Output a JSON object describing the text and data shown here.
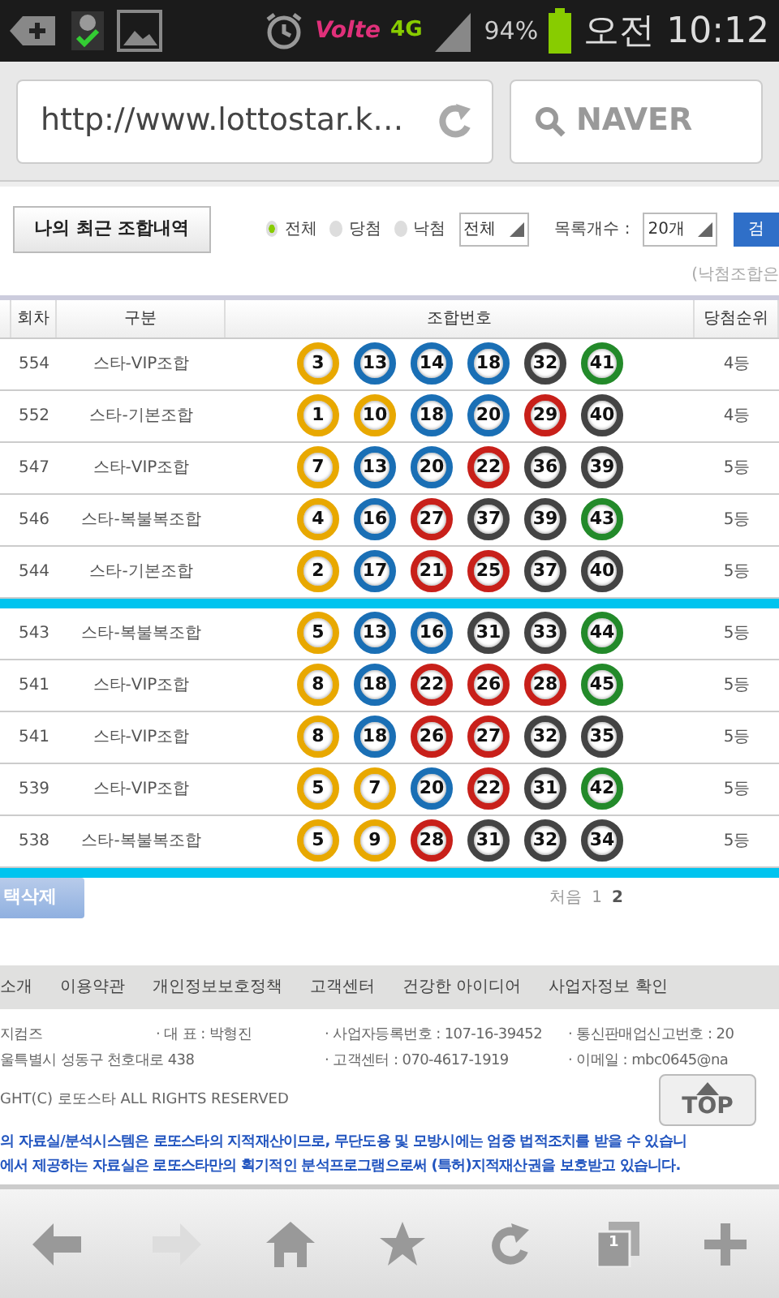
{
  "status_bar": {
    "network": "Volte",
    "data": "4G",
    "battery": "94%",
    "time": "오전 10:12"
  },
  "browser": {
    "url": "http://www.lottostar.k…",
    "search_placeholder": "NAVER"
  },
  "toolbar": {
    "history_button": "나의 최근 조합내역",
    "filters": [
      {
        "label": "전체",
        "selected": true
      },
      {
        "label": "당첨",
        "selected": false
      },
      {
        "label": "낙첨",
        "selected": false
      }
    ],
    "type_select": "전체",
    "count_label": "목록개수 :",
    "count_select": "20개",
    "search_button": "검",
    "note": "(낙첨조합은"
  },
  "table": {
    "columns": [
      "회차",
      "구분",
      "조합번호",
      "당첨순위"
    ],
    "groups": [
      [
        {
          "round": "554",
          "type": "스타-VIP조합",
          "rank": "4등",
          "balls": [
            {
              "n": "3",
              "color": "#e8a800"
            },
            {
              "n": "13",
              "color": "#1a6fb5"
            },
            {
              "n": "14",
              "color": "#1a6fb5"
            },
            {
              "n": "18",
              "color": "#1a6fb5"
            },
            {
              "n": "32",
              "color": "#444444"
            },
            {
              "n": "41",
              "color": "#238a2a"
            }
          ]
        },
        {
          "round": "552",
          "type": "스타-기본조합",
          "rank": "4등",
          "balls": [
            {
              "n": "1",
              "color": "#e8a800"
            },
            {
              "n": "10",
              "color": "#e8a800"
            },
            {
              "n": "18",
              "color": "#1a6fb5"
            },
            {
              "n": "20",
              "color": "#1a6fb5"
            },
            {
              "n": "29",
              "color": "#c8201a"
            },
            {
              "n": "40",
              "color": "#444444"
            }
          ]
        },
        {
          "round": "547",
          "type": "스타-VIP조합",
          "rank": "5등",
          "balls": [
            {
              "n": "7",
              "color": "#e8a800"
            },
            {
              "n": "13",
              "color": "#1a6fb5"
            },
            {
              "n": "20",
              "color": "#1a6fb5"
            },
            {
              "n": "22",
              "color": "#c8201a"
            },
            {
              "n": "36",
              "color": "#444444"
            },
            {
              "n": "39",
              "color": "#444444"
            }
          ]
        },
        {
          "round": "546",
          "type": "스타-복불복조합",
          "rank": "5등",
          "balls": [
            {
              "n": "4",
              "color": "#e8a800"
            },
            {
              "n": "16",
              "color": "#1a6fb5"
            },
            {
              "n": "27",
              "color": "#c8201a"
            },
            {
              "n": "37",
              "color": "#444444"
            },
            {
              "n": "39",
              "color": "#444444"
            },
            {
              "n": "43",
              "color": "#238a2a"
            }
          ]
        },
        {
          "round": "544",
          "type": "스타-기본조합",
          "rank": "5등",
          "balls": [
            {
              "n": "2",
              "color": "#e8a800"
            },
            {
              "n": "17",
              "color": "#1a6fb5"
            },
            {
              "n": "21",
              "color": "#c8201a"
            },
            {
              "n": "25",
              "color": "#c8201a"
            },
            {
              "n": "37",
              "color": "#444444"
            },
            {
              "n": "40",
              "color": "#444444"
            }
          ]
        }
      ],
      [
        {
          "round": "543",
          "type": "스타-복불복조합",
          "rank": "5등",
          "balls": [
            {
              "n": "5",
              "color": "#e8a800"
            },
            {
              "n": "13",
              "color": "#1a6fb5"
            },
            {
              "n": "16",
              "color": "#1a6fb5"
            },
            {
              "n": "31",
              "color": "#444444"
            },
            {
              "n": "33",
              "color": "#444444"
            },
            {
              "n": "44",
              "color": "#238a2a"
            }
          ]
        },
        {
          "round": "541",
          "type": "스타-VIP조합",
          "rank": "5등",
          "balls": [
            {
              "n": "8",
              "color": "#e8a800"
            },
            {
              "n": "18",
              "color": "#1a6fb5"
            },
            {
              "n": "22",
              "color": "#c8201a"
            },
            {
              "n": "26",
              "color": "#c8201a"
            },
            {
              "n": "28",
              "color": "#c8201a"
            },
            {
              "n": "45",
              "color": "#238a2a"
            }
          ]
        },
        {
          "round": "541",
          "type": "스타-VIP조합",
          "rank": "5등",
          "balls": [
            {
              "n": "8",
              "color": "#e8a800"
            },
            {
              "n": "18",
              "color": "#1a6fb5"
            },
            {
              "n": "26",
              "color": "#c8201a"
            },
            {
              "n": "27",
              "color": "#c8201a"
            },
            {
              "n": "32",
              "color": "#444444"
            },
            {
              "n": "35",
              "color": "#444444"
            }
          ]
        },
        {
          "round": "539",
          "type": "스타-VIP조합",
          "rank": "5등",
          "balls": [
            {
              "n": "5",
              "color": "#e8a800"
            },
            {
              "n": "7",
              "color": "#e8a800"
            },
            {
              "n": "20",
              "color": "#1a6fb5"
            },
            {
              "n": "22",
              "color": "#c8201a"
            },
            {
              "n": "31",
              "color": "#444444"
            },
            {
              "n": "42",
              "color": "#238a2a"
            }
          ]
        },
        {
          "round": "538",
          "type": "스타-복불복조합",
          "rank": "5등",
          "balls": [
            {
              "n": "5",
              "color": "#e8a800"
            },
            {
              "n": "9",
              "color": "#e8a800"
            },
            {
              "n": "28",
              "color": "#c8201a"
            },
            {
              "n": "31",
              "color": "#444444"
            },
            {
              "n": "32",
              "color": "#444444"
            },
            {
              "n": "34",
              "color": "#444444"
            }
          ]
        }
      ]
    ]
  },
  "delete_button": "택삭제",
  "pagination": [
    {
      "label": "처음",
      "selected": false
    },
    {
      "label": "1",
      "selected": false
    },
    {
      "label": "2",
      "selected": true
    }
  ],
  "footer_links": [
    "소개",
    "이용약관",
    "개인정보보호정책",
    "고객센터",
    "건강한 아이디어",
    "사업자정보 확인"
  ],
  "footer_info": [
    [
      "지컴즈",
      "· 대 표 : 박형진",
      "· 사업자등록번호 : 107-16-39452",
      "· 통신판매업신고번호 : 20"
    ],
    [
      "울특별시 성동구 천호대로 438",
      "· 고객센터 : 070-4617-1919",
      "· 이메일 : mbc0645@na"
    ]
  ],
  "copyright": "GHT(C) 로또스타 ALL RIGHTS RESERVED",
  "notices": [
    "의 자료실/분석시스템은 로또스타의 지적재산이므로, 무단도용 및 모방시에는 엄중 법적조치를 받을 수 있습니",
    "에서 제공하는 자료실은 로또스타만의 획기적인 분석프로그램으로써 (특허)지적재산권을 보호받고 있습니다."
  ],
  "top_button": "TOP",
  "nav_bar": {
    "tab_count": "1"
  }
}
